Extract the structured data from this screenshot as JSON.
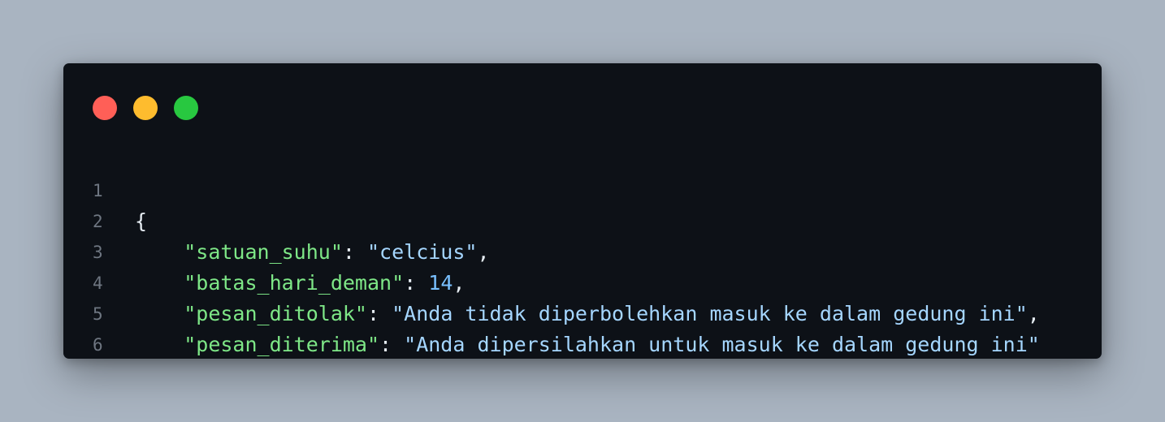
{
  "window": {
    "controls": [
      {
        "name": "close-dot",
        "color": "#ff5f57"
      },
      {
        "name": "minimize-dot",
        "color": "#febc2e"
      },
      {
        "name": "maximize-dot",
        "color": "#28c840"
      }
    ]
  },
  "code": {
    "lines": [
      {
        "number": "1",
        "indent": "",
        "open": "{"
      },
      {
        "number": "2",
        "indent": "    ",
        "key": "\"satuan_suhu\"",
        "sep": ": ",
        "value": "\"celcius\"",
        "value_type": "string",
        "trail": ","
      },
      {
        "number": "3",
        "indent": "    ",
        "key": "\"batas_hari_deman\"",
        "sep": ": ",
        "value": "14",
        "value_type": "number",
        "trail": ","
      },
      {
        "number": "4",
        "indent": "    ",
        "key": "\"pesan_ditolak\"",
        "sep": ": ",
        "value": "\"Anda tidak diperbolehkan masuk ke dalam gedung ini\"",
        "value_type": "string",
        "trail": ","
      },
      {
        "number": "5",
        "indent": "    ",
        "key": "\"pesan_diterima\"",
        "sep": ": ",
        "value": "\"Anda dipersilahkan untuk masuk ke dalam gedung ini\"",
        "value_type": "string",
        "trail": ""
      },
      {
        "number": "6",
        "indent": "  ",
        "open": "}"
      }
    ]
  },
  "colors": {
    "page_bg": "#a9b4c1",
    "editor_bg": "#0d1117",
    "line_number": "#6e7681",
    "key": "#7ee787",
    "string": "#a5d6ff",
    "number": "#79c0ff",
    "punctuation": "#e6edf3"
  }
}
